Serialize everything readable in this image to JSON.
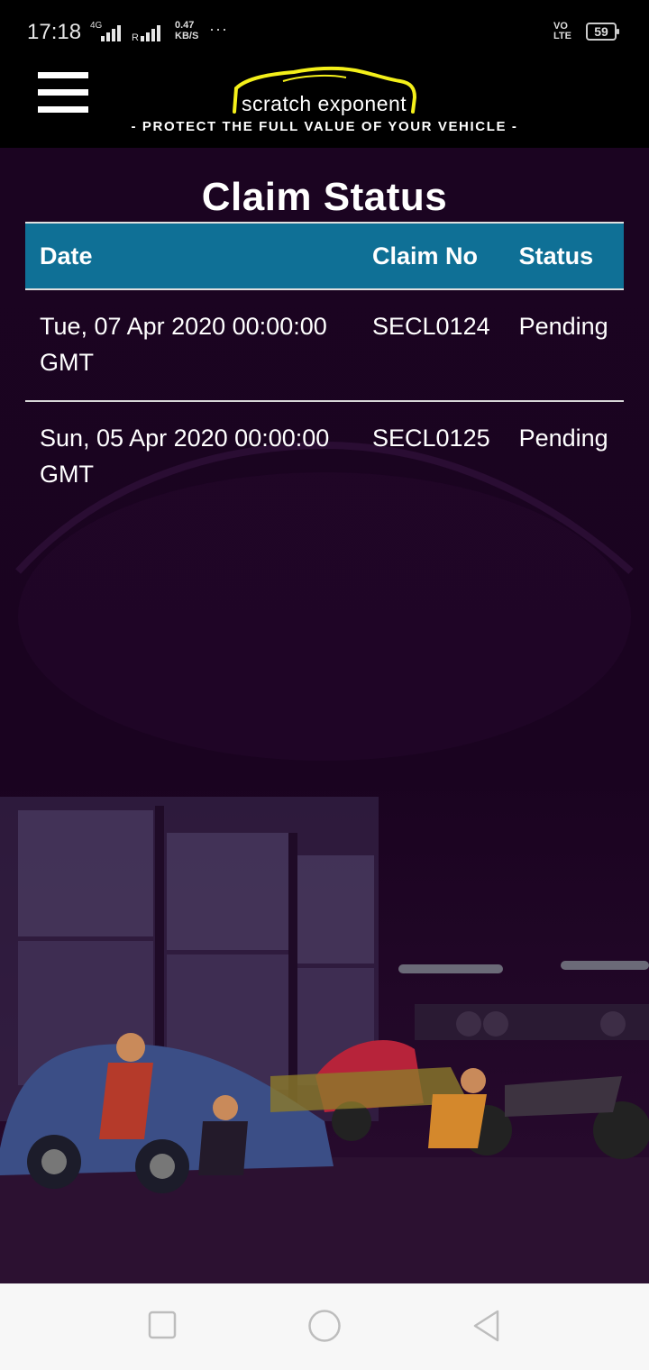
{
  "status_bar": {
    "time": "17:18",
    "net_type": "4G",
    "roaming": "R",
    "speed_value": "0.47",
    "speed_unit": "KB/S",
    "more": "···",
    "volte_top": "VO",
    "volte_bottom": "LTE",
    "battery": "59"
  },
  "header": {
    "logo_text": "scratch exponent",
    "tagline": "- PROTECT THE FULL VALUE OF YOUR VEHICLE -",
    "logo_color": "#f4f01a",
    "menu_icon": "hamburger-icon"
  },
  "page": {
    "title": "Claim Status"
  },
  "table": {
    "columns": [
      "Date",
      "Claim No",
      "Status"
    ],
    "rows": [
      {
        "date": "Tue, 07 Apr 2020 00:00:00 GMT",
        "claim_no": "SECL0124",
        "status": "Pending"
      },
      {
        "date": "Sun, 05 Apr 2020 00:00:00 GMT",
        "claim_no": "SECL0125",
        "status": "Pending"
      }
    ],
    "header_color": "#0f7096"
  },
  "nav_bar": {
    "icons": [
      "recents-square-icon",
      "home-circle-icon",
      "back-triangle-icon"
    ]
  }
}
